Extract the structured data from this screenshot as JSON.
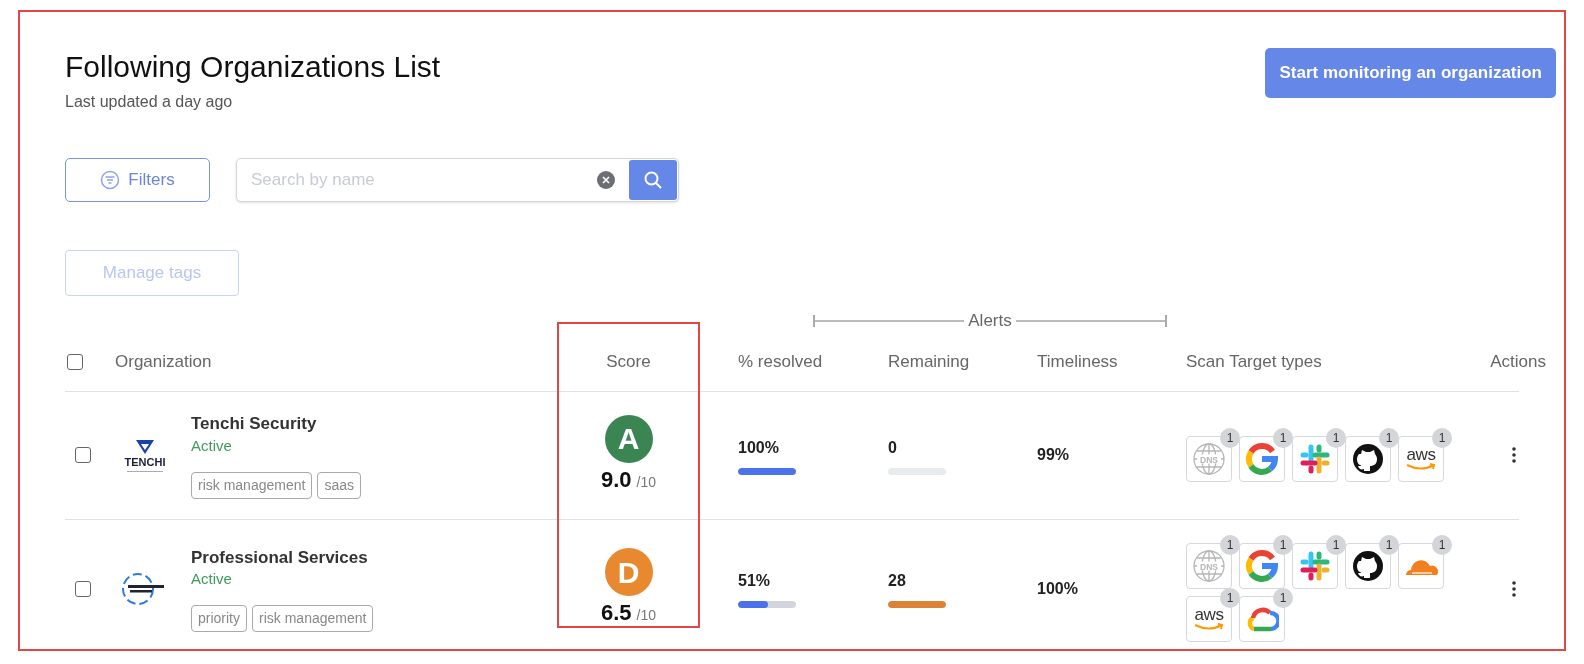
{
  "header": {
    "title": "Following Organizations List",
    "subtitle": "Last updated a day ago",
    "primary_button": "Start monitoring an organization"
  },
  "toolbar": {
    "filters_button": "Filters",
    "search": {
      "placeholder": "Search by name"
    },
    "manage_tags_button": {
      "label": "Manage tags",
      "disabled": true
    }
  },
  "table": {
    "group_header": "Alerts",
    "columns": [
      "Organization",
      "Score",
      "% resolved",
      "Remaining",
      "Timeliness",
      "Scan Target types",
      "Actions"
    ],
    "select_all": {
      "checked": false
    },
    "rows": [
      {
        "checked": false,
        "logo": {
          "kind": "tenchi",
          "text": "TENCHI"
        },
        "name": "Tenchi Security",
        "status": "Active",
        "tags": [
          "risk management",
          "saas"
        ],
        "grade": {
          "letter": "A",
          "color": "#3b8552"
        },
        "score": "9.0",
        "score_max": "/10",
        "resolved": {
          "value": "100%",
          "level": 1
        },
        "remaining": {
          "value": "0",
          "level": 0
        },
        "timeliness": "99%",
        "scan_targets": [
          {
            "kind": "dns",
            "label": "DNS",
            "count": "1"
          },
          {
            "kind": "google",
            "count": "1"
          },
          {
            "kind": "slack",
            "count": "1"
          },
          {
            "kind": "github",
            "count": "1"
          },
          {
            "kind": "aws",
            "label": "aws",
            "count": "1"
          }
        ]
      },
      {
        "checked": false,
        "logo": {
          "kind": "ring"
        },
        "name": "Professional Services",
        "status": "Active",
        "tags": [
          "priority",
          "risk management"
        ],
        "grade": {
          "letter": "D",
          "color": "#e8892f"
        },
        "score": "6.5",
        "score_max": "/10",
        "resolved": {
          "value": "51%",
          "level": 0.51
        },
        "remaining": {
          "value": "28",
          "level": 1
        },
        "timeliness": "100%",
        "scan_targets": [
          {
            "kind": "dns",
            "label": "DNS",
            "count": "1"
          },
          {
            "kind": "google",
            "count": "1"
          },
          {
            "kind": "slack",
            "count": "1"
          },
          {
            "kind": "github",
            "count": "1"
          },
          {
            "kind": "cloudflare",
            "count": "1"
          },
          {
            "kind": "aws",
            "label": "aws",
            "count": "1"
          },
          {
            "kind": "gcp",
            "count": "1"
          }
        ]
      }
    ]
  }
}
